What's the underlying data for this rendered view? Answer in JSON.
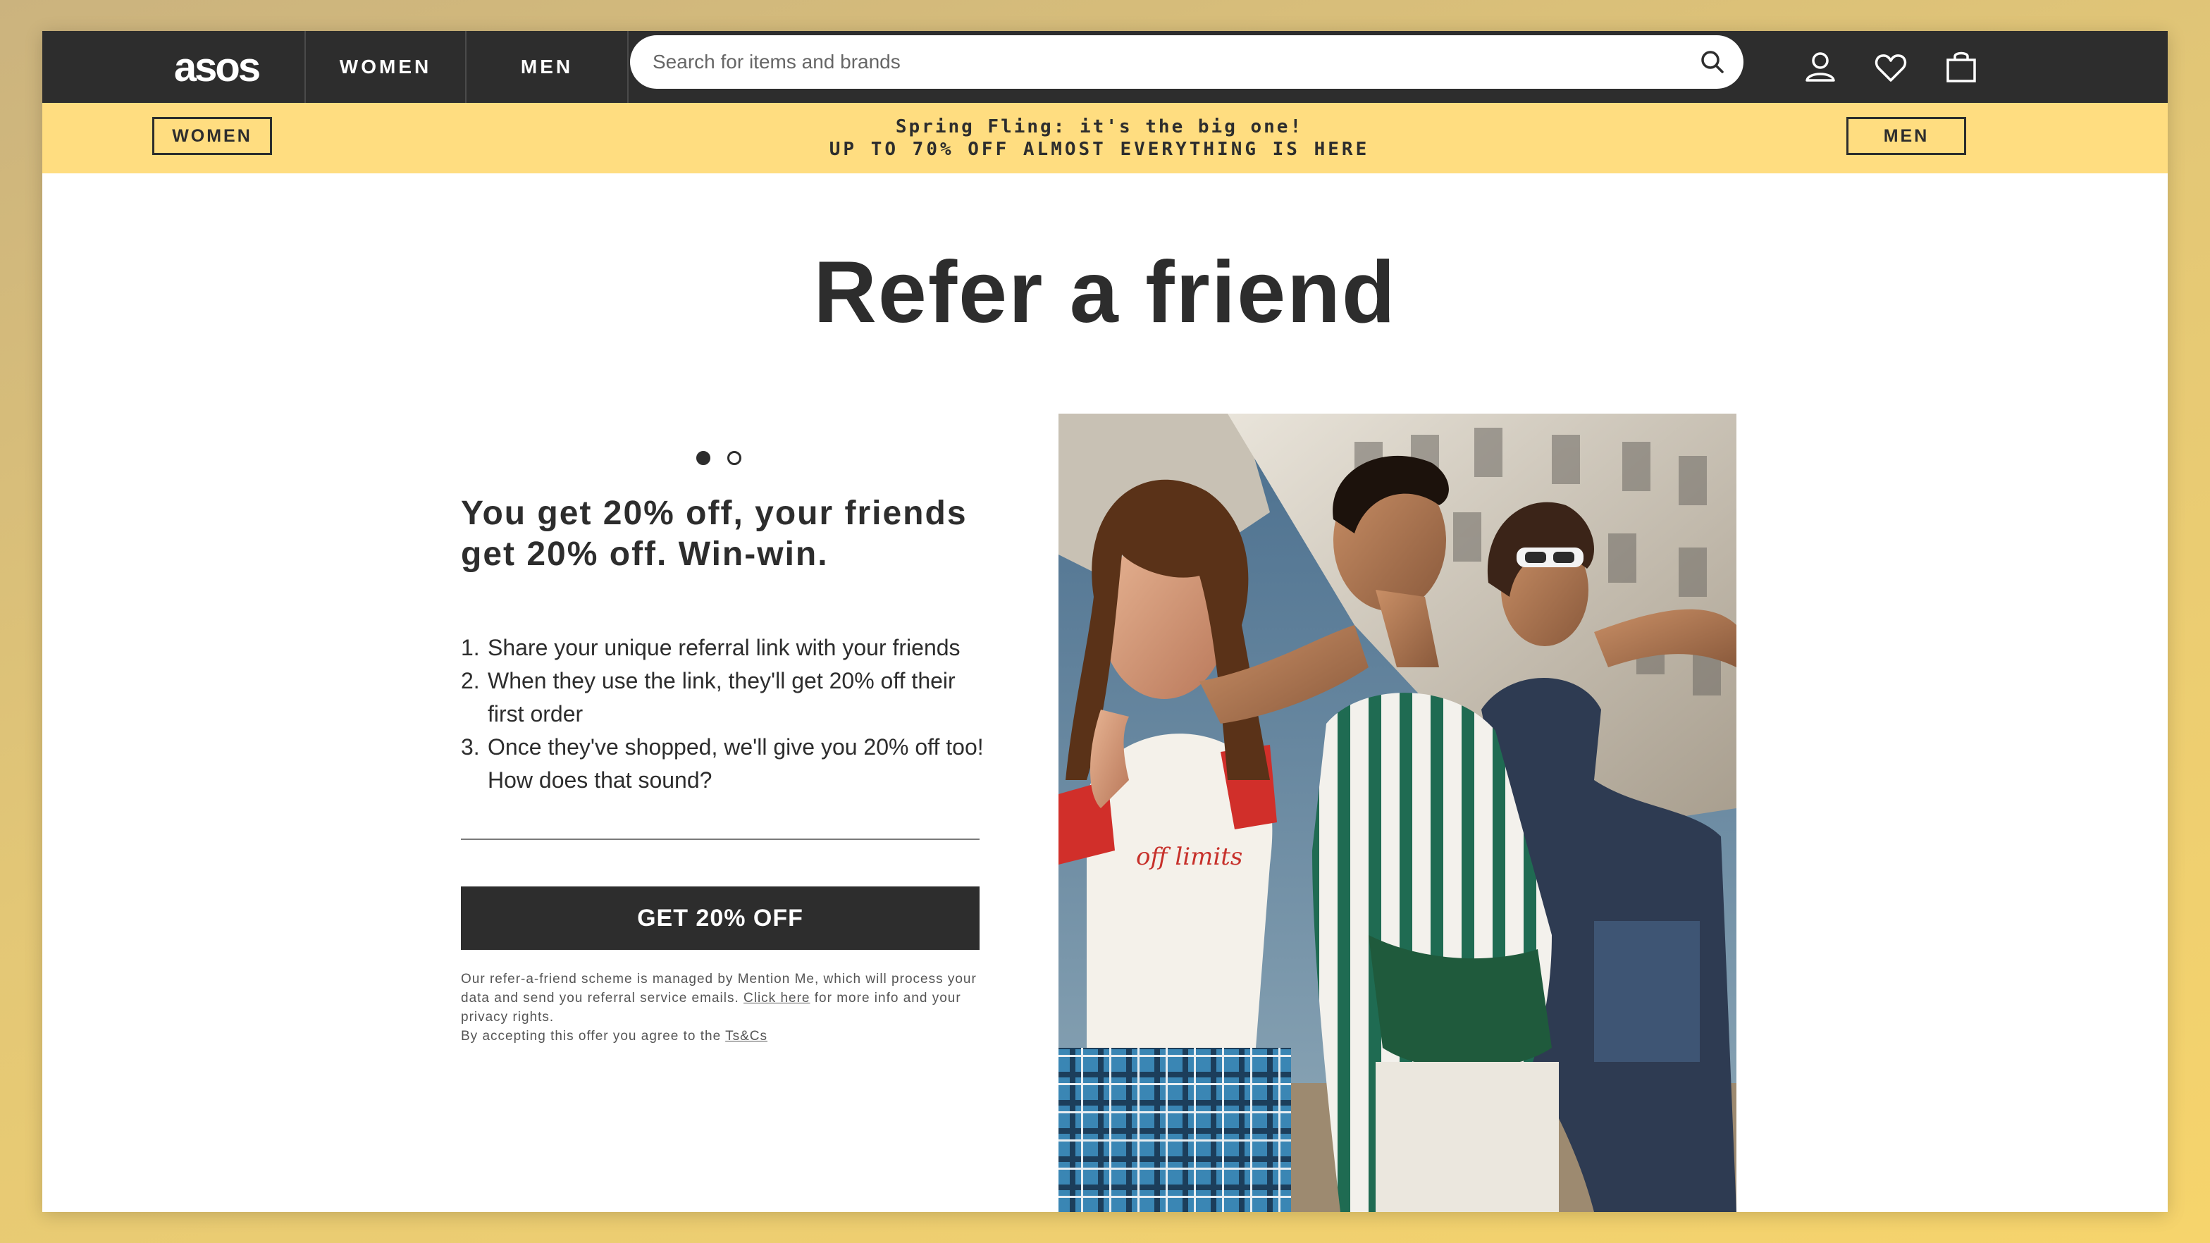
{
  "brand": {
    "logo": "asos"
  },
  "nav": {
    "women": "WOMEN",
    "men": "MEN",
    "search_placeholder": "Search for items and brands",
    "icons": [
      "account-icon",
      "heart-icon",
      "bag-icon",
      "search-icon"
    ]
  },
  "promo": {
    "women_button": "WOMEN",
    "men_button": "MEN",
    "line1": "Spring Fling: it's the big one!",
    "line2": "UP TO 70% OFF ALMOST EVERYTHING IS HERE",
    "background": "#ffdd80"
  },
  "main": {
    "title": "Refer a friend",
    "carousel": {
      "slides": 2,
      "active": 1
    },
    "headline": "You get 20% off, your friends get 20% off. Win-win.",
    "steps": [
      {
        "num": "1.",
        "text": "Share your unique referral link with your friends"
      },
      {
        "num": "2.",
        "text": "When they use the link, they'll get 20% off their first order"
      },
      {
        "num": "3.",
        "text": "Once they've shopped, we'll give you 20% off too! How does that sound?"
      }
    ],
    "cta": "GET 20% OFF",
    "fine_print": {
      "part1": "Our refer-a-friend scheme is managed by Mention Me, which will process your data and send you referral service emails. ",
      "link1": "Click here",
      "part2": " for more info and your privacy rights.",
      "part3": "By accepting this offer you agree to the ",
      "link2": "Ts&Cs"
    }
  },
  "colors": {
    "dark": "#2d2d2d",
    "promo_yellow": "#ffdd80",
    "white": "#ffffff"
  }
}
